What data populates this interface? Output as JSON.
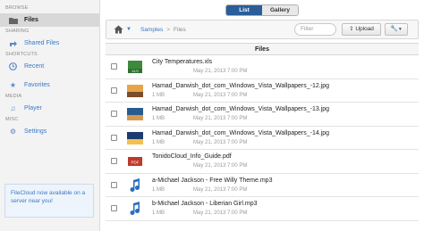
{
  "sidebar": {
    "sections": {
      "browse": "BROWSE",
      "sharing": "SHARING",
      "shortcuts": "SHORTCUTS",
      "media": "MEDIA",
      "misc": "MISC"
    },
    "items": {
      "files": "Files",
      "shared_files": "Shared Files",
      "recent": "Recent",
      "favorites": "Favorites",
      "player": "Player",
      "settings": "Settings"
    },
    "promo": "FileCloud now available on a server near you!"
  },
  "view_toggle": {
    "list": "List",
    "gallery": "Gallery",
    "selected": "List"
  },
  "toolbar": {
    "breadcrumb": [
      "Samples",
      "Files"
    ],
    "filter_placeholder": "Filter",
    "upload_label": "Upload"
  },
  "table": {
    "header": "Files",
    "rows": [
      {
        "name": "City Temperatures.xls",
        "size": "",
        "modified": "May 21, 2013 7:00 PM",
        "icon": "xls-icon"
      },
      {
        "name": "Hamad_Darwish_dot_com_Windows_Vista_Wallpapers_-12.jpg",
        "size": "1 MB",
        "modified": "May 21, 2013 7:00 PM",
        "icon": "image-thumbnail"
      },
      {
        "name": "Hamad_Darwish_dot_com_Windows_Vista_Wallpapers_-13.jpg",
        "size": "1 MB",
        "modified": "May 21, 2013 7:00 PM",
        "icon": "image-thumbnail"
      },
      {
        "name": "Hamad_Darwish_dot_com_Windows_Vista_Wallpapers_-14.jpg",
        "size": "1 MB",
        "modified": "May 21, 2013 7:00 PM",
        "icon": "image-thumbnail"
      },
      {
        "name": "TonidoCloud_Info_Guide.pdf",
        "size": "",
        "modified": "May 21, 2013 7:00 PM",
        "icon": "pdf-icon"
      },
      {
        "name": "a-Michael Jackson - Free Willy Theme.mp3",
        "size": "1 MB",
        "modified": "May 21, 2013 7:00 PM",
        "icon": "music-note-icon"
      },
      {
        "name": "b-Michael Jackson - Liberian Girl.mp3",
        "size": "1 MB",
        "modified": "May 21, 2013 7:00 PM",
        "icon": "music-note-icon"
      }
    ]
  },
  "colors": {
    "link": "#3a79c5",
    "toggle_active": "#2a5d9a"
  }
}
